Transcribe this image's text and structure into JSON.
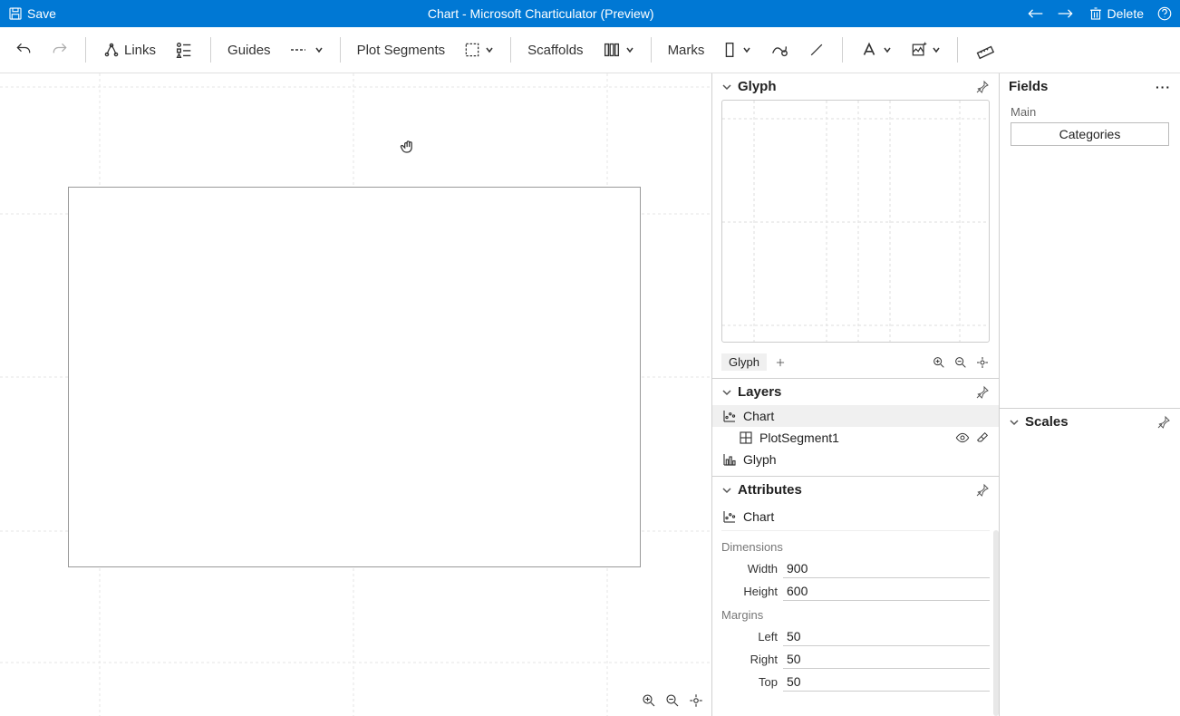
{
  "titlebar": {
    "save": "Save",
    "title": "Chart - Microsoft Charticulator (Preview)",
    "delete": "Delete"
  },
  "toolbar": {
    "links": "Links",
    "guides": "Guides",
    "plot_segments": "Plot Segments",
    "scaffolds": "Scaffolds",
    "marks": "Marks"
  },
  "panels": {
    "glyph": "Glyph",
    "glyph_label": "Glyph",
    "layers": "Layers",
    "attributes": "Attributes",
    "fields": "Fields",
    "scales": "Scales"
  },
  "layers": {
    "chart": "Chart",
    "plotsegment": "PlotSegment1",
    "glyph": "Glyph"
  },
  "attributes": {
    "chart": "Chart",
    "dimensions_label": "Dimensions",
    "width_label": "Width",
    "width_value": "900",
    "height_label": "Height",
    "height_value": "600",
    "margins_label": "Margins",
    "left_label": "Left",
    "left_value": "50",
    "right_label": "Right",
    "right_value": "50",
    "top_label": "Top",
    "top_value": "50"
  },
  "fields": {
    "main_label": "Main",
    "categories": "Categories"
  }
}
